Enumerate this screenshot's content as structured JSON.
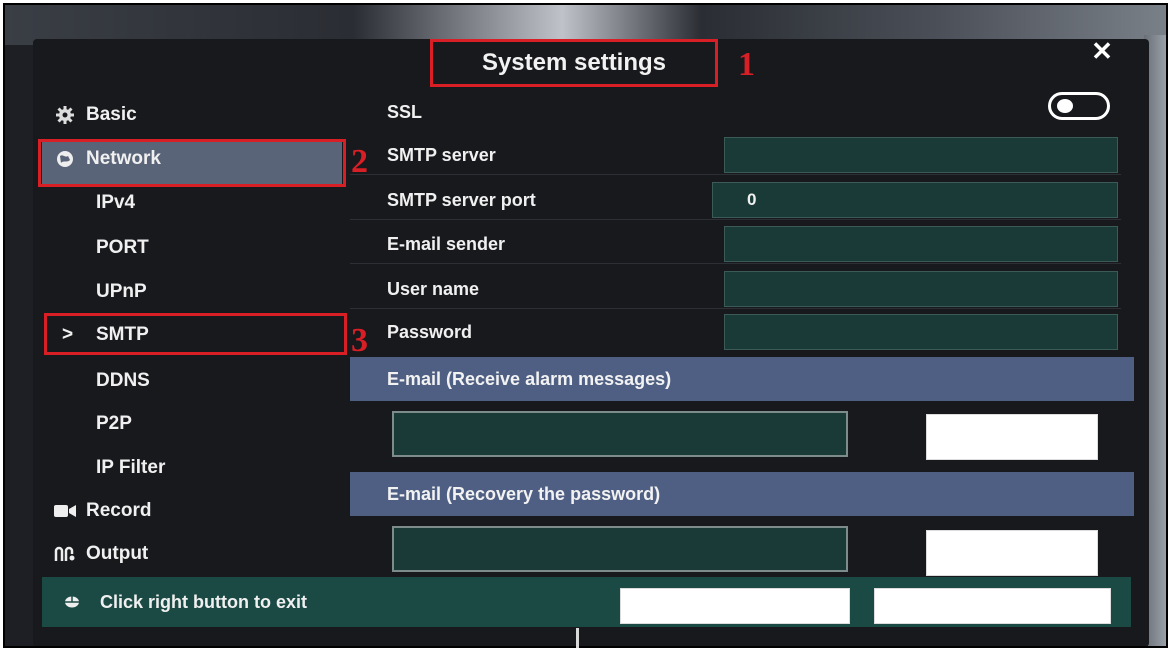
{
  "window": {
    "title": "System settings",
    "close_glyph": "✕"
  },
  "annotations": [
    "1",
    "2",
    "3"
  ],
  "sidebar": {
    "items": [
      {
        "label": "Basic",
        "icon": "gear-icon"
      },
      {
        "label": "Network",
        "icon": "globe-icon",
        "selected": true
      },
      {
        "label": "IPv4"
      },
      {
        "label": "PORT"
      },
      {
        "label": "UPnP"
      },
      {
        "label": "SMTP",
        "prefix": ">",
        "current": true
      },
      {
        "label": "DDNS"
      },
      {
        "label": "P2P"
      },
      {
        "label": "IP Filter"
      },
      {
        "label": "Record",
        "icon": "camera-icon"
      },
      {
        "label": "Output",
        "icon": "output-icon"
      }
    ]
  },
  "smtp": {
    "ssl_label": "SSL",
    "ssl_enabled": false,
    "fields": [
      {
        "label": "SMTP server",
        "value": ""
      },
      {
        "label": "SMTP server port",
        "value": "0"
      },
      {
        "label": "E-mail sender",
        "value": ""
      },
      {
        "label": "User name",
        "value": ""
      },
      {
        "label": "Password",
        "value": ""
      }
    ],
    "alarm_section": "E-mail (Receive alarm messages)",
    "recovery_section": "E-mail (Recovery the password)"
  },
  "footer": {
    "hint": "Click right button to exit"
  },
  "colors": {
    "annotation_red": "#d81f26",
    "panel_bg": "#17191d",
    "field_bg": "#1a3a37",
    "section_bg": "#4f5f83",
    "selected_bg": "#5a6478",
    "footer_bg": "#1b4a45"
  }
}
